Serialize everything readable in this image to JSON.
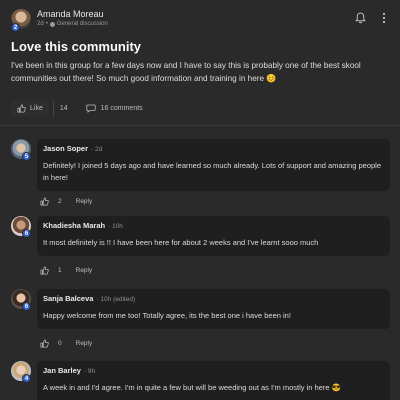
{
  "post": {
    "author": "Amanda Moreau",
    "level": "2",
    "time": "2d",
    "separator": "•",
    "category": "General discussion",
    "title": "Love this community",
    "body": "I've been in this group for a few days now and I have to say this is probably one of the best skool communities out there! So much good information and training in here 😊",
    "like_label": "Like",
    "like_count": "14",
    "comments_label": "16 comments"
  },
  "icons": {
    "bell": "bell-icon",
    "more": "more-icon",
    "thumb": "thumbs-up-icon",
    "comment": "comment-icon",
    "level_color": "#2f5fd0"
  },
  "comments": [
    {
      "name": "Jason Soper",
      "meta": "· 2d",
      "level": "5",
      "text": "Definitely! I joined 5 days ago and have learned so much already. Lots of support and amazing people in here!",
      "likes": "2",
      "reply": "Reply"
    },
    {
      "name": "Khadiesha Marah",
      "meta": "· 10h",
      "level": "6",
      "text": "It most definitely is !! I have been here for about 2 weeks and I've learnt sooo much",
      "likes": "1",
      "reply": "Reply"
    },
    {
      "name": "Sanja Balceva",
      "meta": "· 10h (edited)",
      "level": "6",
      "text": "Happy welcome from me too! Totally agree, its the best one i have been in!",
      "likes": "0",
      "reply": "Reply"
    },
    {
      "name": "Jan Barley",
      "meta": "· 9h",
      "level": "4",
      "text": "A week in and I'd agree. I'm in quite a few but will be weeding out as I'm mostly in here 😎",
      "likes": "",
      "reply": ""
    }
  ]
}
